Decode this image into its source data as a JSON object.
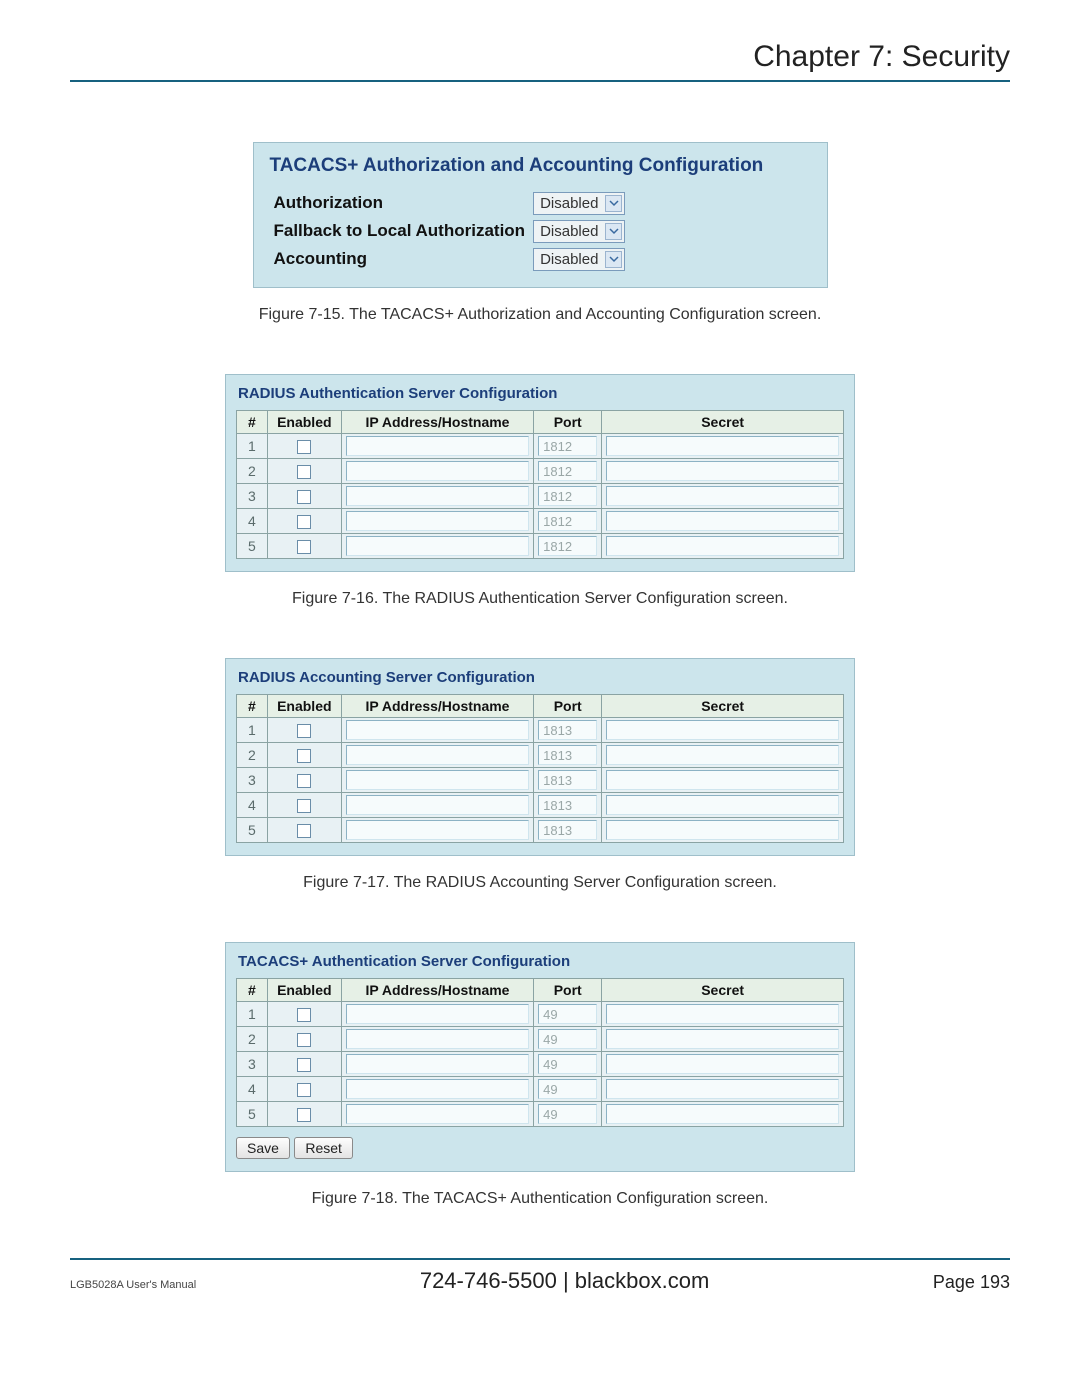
{
  "chapter_title": "Chapter 7: Security",
  "tacacs_auth_accounting": {
    "title": "TACACS+ Authorization and Accounting Configuration",
    "rows": [
      {
        "label": "Authorization",
        "value": "Disabled"
      },
      {
        "label": "Fallback to Local Authorization",
        "value": "Disabled"
      },
      {
        "label": "Accounting",
        "value": "Disabled"
      }
    ]
  },
  "captions": {
    "c715": "Figure 7-15. The TACACS+ Authorization and Accounting Configuration screen.",
    "c716": "Figure 7-16. The RADIUS Authentication Server Configuration screen.",
    "c717": "Figure 7-17. The RADIUS Accounting Server Configuration screen.",
    "c718": "Figure 7-18. The TACACS+ Authentication Configuration screen."
  },
  "server_tables": {
    "headers": {
      "num": "#",
      "enabled": "Enabled",
      "ip": "IP Address/Hostname",
      "port": "Port",
      "secret": "Secret"
    },
    "radius_auth": {
      "title": "RADIUS Authentication Server Configuration",
      "rows": [
        {
          "n": "1",
          "port": "1812"
        },
        {
          "n": "2",
          "port": "1812"
        },
        {
          "n": "3",
          "port": "1812"
        },
        {
          "n": "4",
          "port": "1812"
        },
        {
          "n": "5",
          "port": "1812"
        }
      ]
    },
    "radius_acct": {
      "title": "RADIUS Accounting Server Configuration",
      "rows": [
        {
          "n": "1",
          "port": "1813"
        },
        {
          "n": "2",
          "port": "1813"
        },
        {
          "n": "3",
          "port": "1813"
        },
        {
          "n": "4",
          "port": "1813"
        },
        {
          "n": "5",
          "port": "1813"
        }
      ]
    },
    "tacacs_auth": {
      "title": "TACACS+ Authentication Server Configuration",
      "rows": [
        {
          "n": "1",
          "port": "49"
        },
        {
          "n": "2",
          "port": "49"
        },
        {
          "n": "3",
          "port": "49"
        },
        {
          "n": "4",
          "port": "49"
        },
        {
          "n": "5",
          "port": "49"
        }
      ]
    }
  },
  "buttons": {
    "save": "Save",
    "reset": "Reset"
  },
  "footer": {
    "manual": "LGB5028A User's Manual",
    "phone": "724-746-5500",
    "sep": "   |   ",
    "site": "blackbox.com",
    "page_label": "Page ",
    "page_num": "193"
  }
}
